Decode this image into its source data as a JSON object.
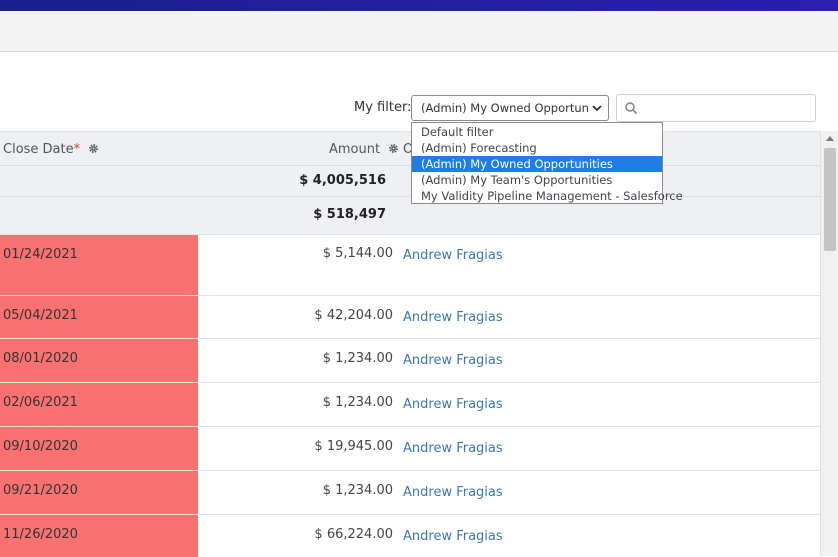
{
  "filter": {
    "label": "My filter:",
    "selected_value": "(Admin) My Owned Opportuniti",
    "options": [
      "Default filter",
      "(Admin) Forecasting",
      "(Admin) My Owned Opportunities",
      "(Admin) My Team's Opportunities",
      "My Validity Pipeline Management - Salesforce"
    ],
    "highlighted_option": "(Admin) My Owned Opportunities"
  },
  "search": {
    "placeholder": ""
  },
  "table": {
    "columns": {
      "close_date": "Close Date",
      "required_mark": "*",
      "amount": "Amount",
      "owner_partial": "O"
    },
    "summary": [
      "$ 4,005,516",
      "$ 518,497"
    ],
    "rows": [
      {
        "close_date": "01/24/2021",
        "amount": "$ 5,144.00",
        "owner": "Andrew Fragias"
      },
      {
        "close_date": "05/04/2021",
        "amount": "$ 42,204.00",
        "owner": "Andrew Fragias"
      },
      {
        "close_date": "08/01/2020",
        "amount": "$ 1,234.00",
        "owner": "Andrew Fragias"
      },
      {
        "close_date": "02/06/2021",
        "amount": "$ 1,234.00",
        "owner": "Andrew Fragias"
      },
      {
        "close_date": "09/10/2020",
        "amount": "$ 19,945.00",
        "owner": "Andrew Fragias"
      },
      {
        "close_date": "09/21/2020",
        "amount": "$ 1,234.00",
        "owner": "Andrew Fragias"
      },
      {
        "close_date": "11/26/2020",
        "amount": "$ 66,224.00",
        "owner": "Andrew Fragias"
      }
    ]
  },
  "colors": {
    "top_bar": "#1a1f8e",
    "overdue_cell": "#f97171",
    "selected_option": "#1e7ee6",
    "owner_link": "#3c77b0"
  },
  "icons": {
    "settings": "gear-icon",
    "search": "search-icon",
    "dropdown": "chevron-down-icon",
    "scroll_up": "scroll-up-arrow-icon"
  }
}
